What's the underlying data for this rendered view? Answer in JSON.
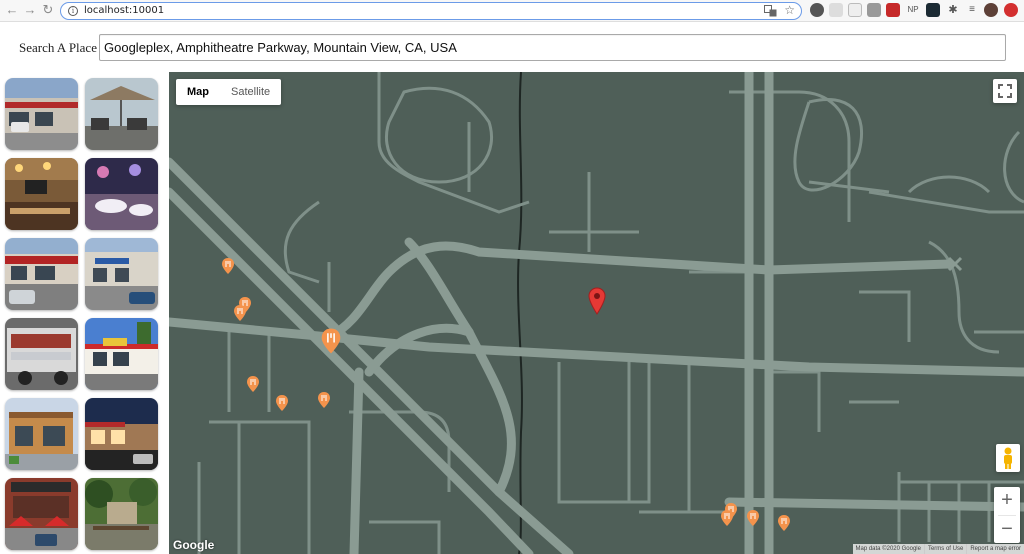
{
  "browser": {
    "url": "localhost:10001",
    "extensions": [
      "NP"
    ]
  },
  "search": {
    "label": "Search A Place",
    "value": "Googleplex, Amphitheatre Parkway, Mountain View, CA, USA"
  },
  "map": {
    "type_buttons": {
      "map": "Map",
      "satellite": "Satellite"
    },
    "selected_type": "Map",
    "zoom_in": "+",
    "zoom_out": "−",
    "logo": "Google",
    "attribution": {
      "data": "Map data ©2020 Google",
      "terms": "Terms of Use",
      "report": "Report a map error"
    }
  },
  "photos": [
    {
      "name": "restaurant-exterior-red-awning"
    },
    {
      "name": "patio-with-umbrellas"
    },
    {
      "name": "interior-dining-counter"
    },
    {
      "name": "banquet-room-balloons"
    },
    {
      "name": "storefront-parking-lot"
    },
    {
      "name": "corner-storefront-blue-sign"
    },
    {
      "name": "food-truck"
    },
    {
      "name": "in-n-out-burger"
    },
    {
      "name": "corner-building-tan"
    },
    {
      "name": "storefront-dusk"
    },
    {
      "name": "restaurant-red-umbrellas"
    },
    {
      "name": "garden-patio"
    }
  ],
  "colors": {
    "map_bg": "#4f5f58",
    "road": "#8a9b93",
    "pin_red": "#e53935",
    "poi_orange": "#f4934c"
  },
  "icons": [
    "back-icon",
    "forward-icon",
    "reload-icon",
    "info-icon",
    "translate-icon",
    "star-icon",
    "fullscreen-icon",
    "pegman-icon",
    "location-pin-icon",
    "restaurant-icon"
  ]
}
